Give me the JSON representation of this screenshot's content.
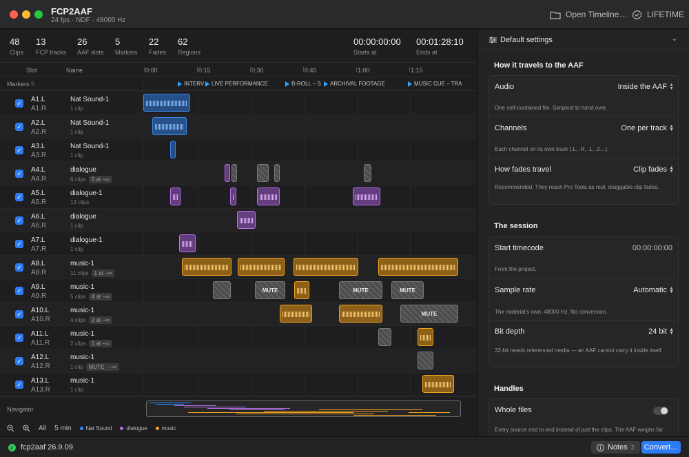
{
  "window": {
    "title": "FCP2AAF",
    "subtitle": "24 fps · NDF · 48000 Hz",
    "open_timeline": "Open Timeline…",
    "license": "LIFETIME"
  },
  "stats": [
    {
      "value": "48",
      "label": "Clips"
    },
    {
      "value": "13",
      "label": "FCP tracks"
    },
    {
      "value": "26",
      "label": "AAF slots"
    },
    {
      "value": "5",
      "label": "Markers"
    },
    {
      "value": "22",
      "label": "Fades"
    },
    {
      "value": "62",
      "label": "Regions"
    },
    {
      "value": "00:00:00:00",
      "label": "Starts at"
    },
    {
      "value": "00:01:28:10",
      "label": "Ends at"
    }
  ],
  "columns": {
    "slot": "Slot",
    "name": "Name"
  },
  "ruler": [
    "0:00",
    "0:15",
    "0:30",
    "0:45",
    "1:00",
    "1:15"
  ],
  "markers": {
    "label": "Markers",
    "count": "5",
    "items": [
      "INTERV",
      "LIVE PERFORMANCE",
      "B-ROLL – S",
      "ARCHIVAL FOOTAGE",
      "MUSIC CUE – TRA"
    ]
  },
  "tracks": [
    {
      "slot_l": "A1.L",
      "slot_r": "A1.R",
      "name": "Nat Sound-1",
      "clips": "1 clip",
      "pill": "",
      "color": "blue"
    },
    {
      "slot_l": "A2.L",
      "slot_r": "A2.R",
      "name": "Nat Sound-1",
      "clips": "1 clip",
      "pill": "",
      "color": "blue"
    },
    {
      "slot_l": "A3.L",
      "slot_r": "A3.R",
      "name": "Nat Sound-1",
      "clips": "1 clip",
      "pill": "",
      "color": "blue"
    },
    {
      "slot_l": "A4.L",
      "slot_r": "A4.R",
      "name": "dialogue",
      "clips": "6 clips",
      "pill": "5 at −∞",
      "color": "purple"
    },
    {
      "slot_l": "A5.L",
      "slot_r": "A5.R",
      "name": "dialogue-1",
      "clips": "13 clips",
      "pill": "",
      "color": "purple"
    },
    {
      "slot_l": "A6.L",
      "slot_r": "A6.R",
      "name": "dialogue",
      "clips": "1 clip",
      "pill": "",
      "color": "purple"
    },
    {
      "slot_l": "A7.L",
      "slot_r": "A7.R",
      "name": "dialogue-1",
      "clips": "1 clip",
      "pill": "",
      "color": "purple"
    },
    {
      "slot_l": "A8.L",
      "slot_r": "A8.R",
      "name": "music-1",
      "clips": "11 clips",
      "pill": "1 at −∞",
      "color": "orange"
    },
    {
      "slot_l": "A9.L",
      "slot_r": "A9.R",
      "name": "music-1",
      "clips": "5 clips",
      "pill": "4 at −∞",
      "color": "orange"
    },
    {
      "slot_l": "A10.L",
      "slot_r": "A10.R",
      "name": "music-1",
      "clips": "4 clips",
      "pill": "2 at −∞",
      "color": "orange"
    },
    {
      "slot_l": "A11.L",
      "slot_r": "A11.R",
      "name": "music-1",
      "clips": "2 clips",
      "pill": "1 at −∞",
      "color": "orange"
    },
    {
      "slot_l": "A12.L",
      "slot_r": "A12.R",
      "name": "music-1",
      "clips": "1 clip",
      "pill": "MUTE · −∞",
      "color": "orange"
    },
    {
      "slot_l": "A13.L",
      "slot_r": "A13.R",
      "name": "music-1",
      "clips": "1 clip",
      "pill": "",
      "color": "orange"
    }
  ],
  "mute_label": "MUTE",
  "navigator": {
    "label": "Navigator",
    "all": "All",
    "zoom": "5 min",
    "legend": [
      {
        "name": "Nat Sound",
        "color": "#2f8cff"
      },
      {
        "name": "dialogue",
        "color": "#b673e6"
      },
      {
        "name": "music",
        "color": "#f0a420"
      }
    ]
  },
  "settings": {
    "preset": "Default settings",
    "travel_title": "How it travels to the AAF",
    "audio_label": "Audio",
    "audio_value": "Inside the AAF",
    "audio_desc": "One self-contained file. Simplest to hand over.",
    "channels_label": "Channels",
    "channels_value": "One per track",
    "channels_desc": "Each channel on its own track (.L, .R, .1, .2…).",
    "fades_label": "How fades travel",
    "fades_value": "Clip fades",
    "fades_desc": "Recommended. They reach Pro Tools as real, draggable clip fades.",
    "session_title": "The session",
    "start_label": "Start timecode",
    "start_value": "00:00:00:00",
    "start_desc": "From the project.",
    "rate_label": "Sample rate",
    "rate_value": "Automatic",
    "rate_desc": "The material's own: 48000 Hz. No conversion.",
    "bit_label": "Bit depth",
    "bit_value": "24 bit",
    "bit_desc": "32-bit needs referenced media — an AAF cannot carry it inside itself.",
    "handles_title": "Handles",
    "whole_label": "Whole files",
    "whole_desc": "Every source end to end instead of just the clips. The AAF weighs far more."
  },
  "status": {
    "version": "fcp2aaf 26.9.09",
    "notes": "Notes",
    "notes_count": "2",
    "convert": "Convert…"
  },
  "colors": {
    "accent": "#2d7cf6",
    "nat_sound": "#2f8cff",
    "dialogue": "#b673e6",
    "music": "#f0a420"
  }
}
